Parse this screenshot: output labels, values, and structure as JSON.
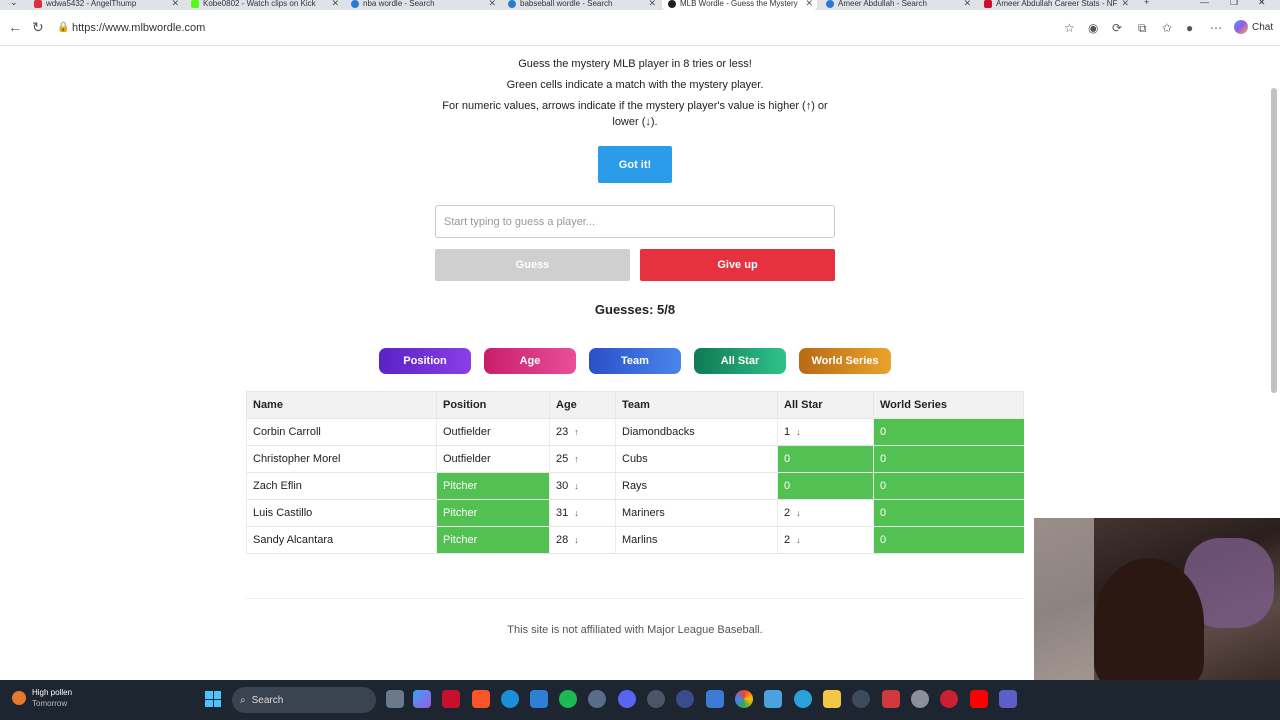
{
  "browser": {
    "tabs": [
      {
        "label": "wdwa5432 - AngelThump",
        "active": false
      },
      {
        "label": "Kobe0802 - Watch clips on Kick",
        "active": false
      },
      {
        "label": "nba wordle - Search",
        "active": false
      },
      {
        "label": "babseball wordle - Search",
        "active": false
      },
      {
        "label": "MLB Wordle - Guess the Mystery",
        "active": true
      },
      {
        "label": "Ameer Abdullah - Search",
        "active": false
      },
      {
        "label": "Ameer Abdullah Career Stats - NF",
        "active": false
      }
    ],
    "url": "https://www.mlbwordle.com",
    "chat_label": "Chat"
  },
  "intro": {
    "line1": "Guess the mystery MLB player in 8 tries or less!",
    "line2": "Green cells indicate a match with the mystery player.",
    "line3": "For numeric values, arrows indicate if the mystery player's value is higher (↑) or lower (↓)."
  },
  "got_it_label": "Got it!",
  "search": {
    "placeholder": "Start typing to guess a player..."
  },
  "guess_label": "Guess",
  "give_up_label": "Give up",
  "guesses_text": "Guesses: 5/8",
  "hints": [
    {
      "label": "Position",
      "color": "#6a2fd6"
    },
    {
      "label": "Age",
      "color": "#d8357a"
    },
    {
      "label": "Team",
      "color": "#3663d8"
    },
    {
      "label": "All Star",
      "color": "#1c9a6a"
    },
    {
      "label": "World Series",
      "color": "#d48a1c"
    }
  ],
  "table": {
    "headers": [
      "Name",
      "Position",
      "Age",
      "Team",
      "All Star",
      "World Series"
    ],
    "rows": [
      {
        "name": "Corbin Carroll",
        "position": "Outfielder",
        "age": "23",
        "age_arrow": "↑",
        "team": "Diamondbacks",
        "allstar": "1",
        "allstar_arrow": "↓",
        "ws": "0"
      },
      {
        "name": "Christopher Morel",
        "position": "Outfielder",
        "age": "25",
        "age_arrow": "↑",
        "team": "Cubs",
        "allstar": "0",
        "allstar_arrow": "",
        "ws": "0"
      },
      {
        "name": "Zach Eflin",
        "position": "Pitcher",
        "age": "30",
        "age_arrow": "↓",
        "team": "Rays",
        "allstar": "0",
        "allstar_arrow": "",
        "ws": "0"
      },
      {
        "name": "Luis Castillo",
        "position": "Pitcher",
        "age": "31",
        "age_arrow": "↓",
        "team": "Mariners",
        "allstar": "2",
        "allstar_arrow": "↓",
        "ws": "0"
      },
      {
        "name": "Sandy Alcantara",
        "position": "Pitcher",
        "age": "28",
        "age_arrow": "↓",
        "team": "Marlins",
        "allstar": "2",
        "allstar_arrow": "↓",
        "ws": "0"
      }
    ]
  },
  "footer": "This site is not affiliated with Major League Baseball.",
  "taskbar": {
    "weather_title": "High pollen",
    "weather_sub": "Tomorrow",
    "search_label": "Search"
  },
  "colors": {
    "match": "#52c152",
    "primary": "#2b9cea",
    "danger": "#e6323e"
  }
}
